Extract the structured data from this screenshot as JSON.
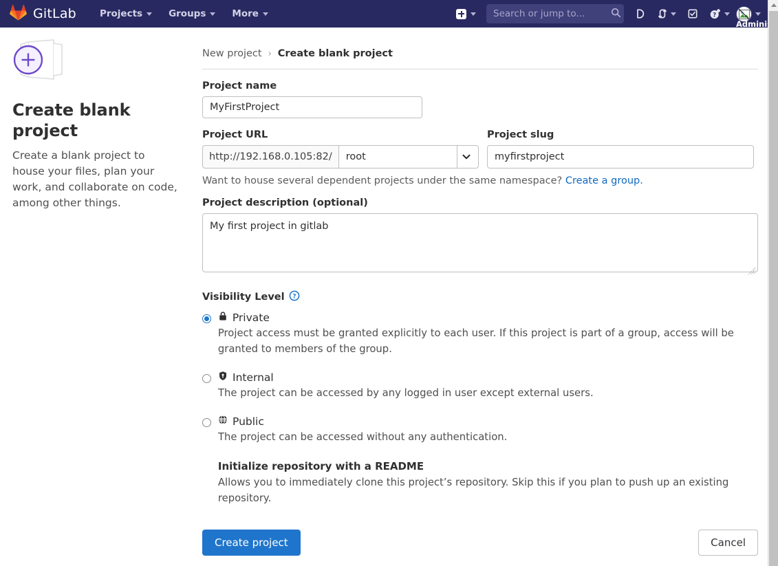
{
  "navbar": {
    "brand_name": "GitLab",
    "brand_logo_icon": "gitlab-tanuki-logo",
    "links": [
      {
        "label": "Projects",
        "icon": "chevron-down-icon"
      },
      {
        "label": "Groups",
        "icon": "chevron-down-icon"
      },
      {
        "label": "More",
        "icon": "chevron-down-icon"
      }
    ],
    "new_icon": "plus-square-icon",
    "search": {
      "placeholder": "Search or jump to...",
      "value": "",
      "icon": "search-icon"
    },
    "icons": [
      {
        "name": "issues-icon"
      },
      {
        "name": "merge-requests-icon"
      },
      {
        "name": "todos-icon"
      },
      {
        "name": "help-icon"
      }
    ],
    "user": {
      "name": "Administrator",
      "avatar_icon": "broken-image-avatar"
    }
  },
  "aside": {
    "icon": "blank-project-plus-icon",
    "title": "Create blank project",
    "description": "Create a blank project to house your files, plan your work, and collaborate on code, among other things."
  },
  "breadcrumb": {
    "parent": "New project",
    "separator": "›",
    "current": "Create blank project"
  },
  "form": {
    "project_name": {
      "label": "Project name",
      "value": "MyFirstProject",
      "placeholder": ""
    },
    "project_url": {
      "label": "Project URL",
      "prefix": "http://192.168.0.105:82/",
      "namespace": "root",
      "chevron_icon": "chevron-down-icon"
    },
    "project_slug": {
      "label": "Project slug",
      "value": "myfirstproject",
      "placeholder": ""
    },
    "namespace_help": {
      "text": "Want to house several dependent projects under the same namespace?",
      "link": "Create a group.",
      "link_color": "#1068bf"
    },
    "project_description": {
      "label": "Project description (optional)",
      "value": "My first project in gitlab",
      "placeholder": ""
    },
    "visibility": {
      "label": "Visibility Level",
      "help_icon": "question-circle-icon",
      "options": [
        {
          "id": "private",
          "icon": "lock-icon",
          "title": "Private",
          "description": "Project access must be granted explicitly to each user. If this project is part of a group, access will be granted to members of the group.",
          "selected": true
        },
        {
          "id": "internal",
          "icon": "shield-icon",
          "title": "Internal",
          "description": "The project can be accessed by any logged in user except external users.",
          "selected": false
        },
        {
          "id": "public",
          "icon": "globe-icon",
          "title": "Public",
          "description": "The project can be accessed without any authentication.",
          "selected": false
        }
      ]
    },
    "readme": {
      "label": "Initialize repository with a README",
      "description": "Allows you to immediately clone this project’s repository. Skip this if you plan to push up an existing repository.",
      "checked": true,
      "check_icon": "checkmark-icon"
    },
    "actions": {
      "submit_label": "Create project",
      "cancel_label": "Cancel"
    }
  },
  "colors": {
    "navbar_bg": "#292961",
    "accent_blue": "#1f75cb",
    "link_blue": "#1068bf",
    "purple": "#6e49cb",
    "text": "#303030"
  },
  "scrollbar": {
    "up_arrow_icon": "triangle-up-icon"
  }
}
